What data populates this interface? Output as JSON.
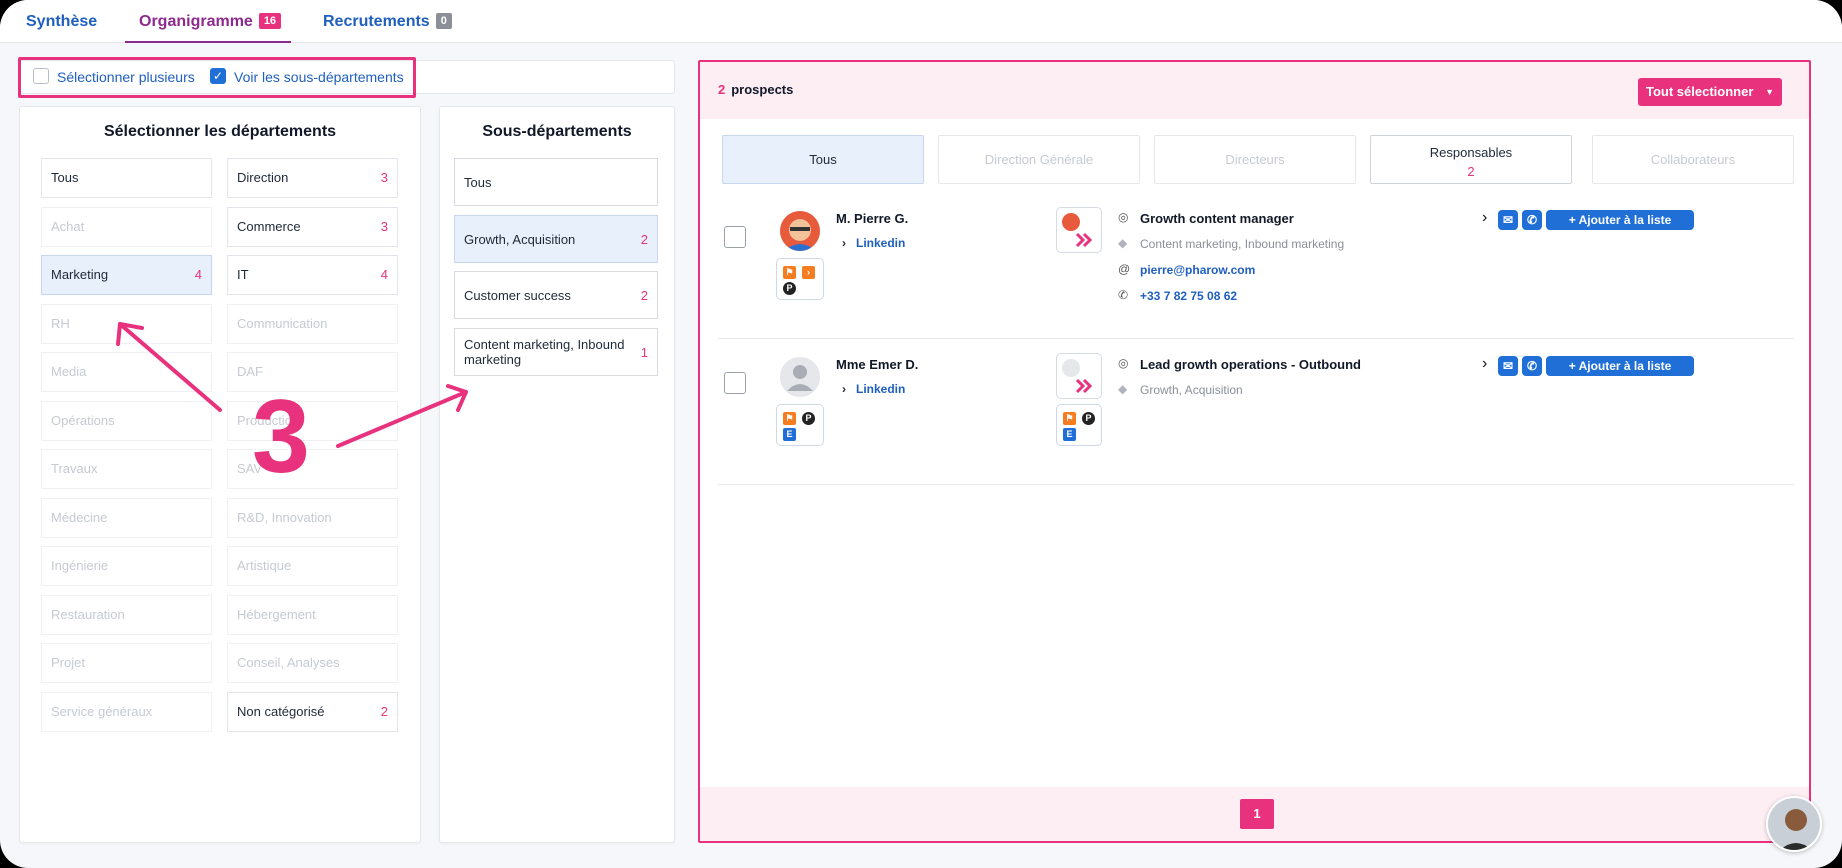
{
  "tabs": [
    {
      "label": "Synthèse",
      "badge": ""
    },
    {
      "label": "Organigramme",
      "badge": "16"
    },
    {
      "label": "Recrutements",
      "badge": "0"
    }
  ],
  "options": {
    "select_multiple": "Sélectionner plusieurs",
    "show_subdepartments": "Voir les sous-départements"
  },
  "departments": {
    "title": "Sélectionner les départements",
    "left": [
      {
        "label": "Tous",
        "count": ""
      },
      {
        "label": "Achat",
        "count": ""
      },
      {
        "label": "Marketing",
        "count": "4"
      },
      {
        "label": "RH",
        "count": ""
      },
      {
        "label": "Media",
        "count": ""
      },
      {
        "label": "Opérations",
        "count": ""
      },
      {
        "label": "Travaux",
        "count": ""
      },
      {
        "label": "Médecine",
        "count": ""
      },
      {
        "label": "Ingénierie",
        "count": ""
      },
      {
        "label": "Restauration",
        "count": ""
      },
      {
        "label": "Projet",
        "count": ""
      },
      {
        "label": "Service généraux",
        "count": ""
      }
    ],
    "right": [
      {
        "label": "Direction",
        "count": "3"
      },
      {
        "label": "Commerce",
        "count": "3"
      },
      {
        "label": "IT",
        "count": "4"
      },
      {
        "label": "Communication",
        "count": ""
      },
      {
        "label": "DAF",
        "count": ""
      },
      {
        "label": "Production",
        "count": ""
      },
      {
        "label": "SAV",
        "count": ""
      },
      {
        "label": "R&D, Innovation",
        "count": ""
      },
      {
        "label": "Artistique",
        "count": ""
      },
      {
        "label": "Hébergement",
        "count": ""
      },
      {
        "label": "Conseil, Analyses",
        "count": ""
      },
      {
        "label": "Non catégorisé",
        "count": "2"
      }
    ]
  },
  "subdepartments": {
    "title": "Sous-départements",
    "items": [
      {
        "label": "Tous",
        "count": ""
      },
      {
        "label": "Growth, Acquisition",
        "count": "2"
      },
      {
        "label": "Customer success",
        "count": "2"
      },
      {
        "label": "Content marketing, Inbound marketing",
        "count": "1"
      }
    ]
  },
  "annotation": "3",
  "prospects": {
    "count": "2",
    "count_label": "prospects",
    "select_all": "Tout sélectionner",
    "filters": [
      {
        "label": "Tous",
        "count": ""
      },
      {
        "label": "Direction Générale",
        "count": ""
      },
      {
        "label": "Directeurs",
        "count": ""
      },
      {
        "label": "Responsables",
        "count": "2"
      },
      {
        "label": "Collaborateurs",
        "count": ""
      }
    ],
    "rows": [
      {
        "name": "M. Pierre G.",
        "linkedin": "Linkedin",
        "title": "Growth content manager",
        "tags": "Content marketing, Inbound marketing",
        "email": "pierre@pharow.com",
        "phone": "+33 7 82 75 08 62",
        "add_label": "Ajouter à la liste"
      },
      {
        "name": "Mme Emer D.",
        "linkedin": "Linkedin",
        "title": "Lead growth operations - Outbound",
        "tags": "Growth, Acquisition",
        "email": "",
        "phone": "",
        "add_label": "Ajouter à la liste"
      }
    ],
    "page": "1"
  },
  "colors": {
    "accent": "#e8327d",
    "primary": "#1f6fd6",
    "tab_active": "#8e2a8e"
  }
}
